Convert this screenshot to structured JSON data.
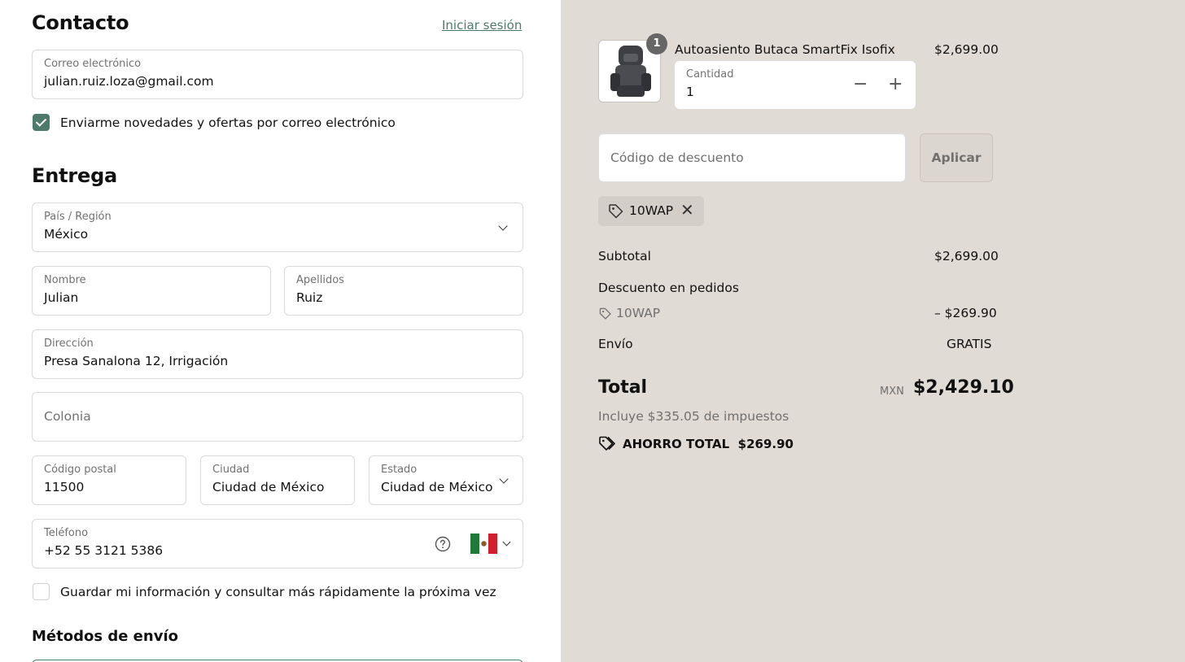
{
  "contact": {
    "title": "Contacto",
    "login_link": "Iniciar sesión",
    "email": {
      "label": "Correo electrónico",
      "value": "julian.ruiz.loza@gmail.com"
    },
    "newsletter": {
      "label": "Enviarme novedades y ofertas por correo electrónico",
      "checked": true
    }
  },
  "delivery": {
    "title": "Entrega",
    "country": {
      "label": "País / Región",
      "value": "México"
    },
    "first_name": {
      "label": "Nombre",
      "value": "Julian"
    },
    "last_name": {
      "label": "Apellidos",
      "value": "Ruiz"
    },
    "address": {
      "label": "Dirección",
      "value": "Presa Sanalona 12, Irrigación"
    },
    "colonia": {
      "placeholder": "Colonia"
    },
    "postal_code": {
      "label": "Código postal",
      "value": "11500"
    },
    "city": {
      "label": "Ciudad",
      "value": "Ciudad de México"
    },
    "state": {
      "label": "Estado",
      "value": "Ciudad de México"
    },
    "phone": {
      "label": "Teléfono",
      "value": "+52 55 3121 5386",
      "help_icon": "question-circle-icon",
      "flag_icon": "mexico-flag-icon"
    },
    "save_info": {
      "label": "Guardar mi información y consultar más rápidamente la próxima vez",
      "checked": false
    }
  },
  "shipping": {
    "title": "Métodos de envío"
  },
  "summary": {
    "product": {
      "name": "Autoasiento Butaca SmartFix Isofix",
      "price": "$2,699.00",
      "badge": "1",
      "quantity_label": "Cantidad",
      "quantity": "1",
      "minus": "−",
      "plus": "+"
    },
    "discount": {
      "placeholder": "Código de descuento",
      "apply_label": "Aplicar",
      "applied_code": "10WAP",
      "remove": "✕"
    },
    "subtotal": {
      "label": "Subtotal",
      "value": "$2,699.00"
    },
    "order_discount": {
      "label": "Descuento en pedidos",
      "code": "10WAP",
      "value": "– $269.90"
    },
    "shipping": {
      "label": "Envío",
      "value": "GRATIS"
    },
    "total": {
      "label": "Total",
      "currency": "MXN",
      "value": "$2,429.10"
    },
    "taxes": "Incluye $335.05 de impuestos",
    "savings": {
      "label": "AHORRO TOTAL",
      "value": "$269.90"
    }
  },
  "colors": {
    "accent": "#4e7a6b",
    "summary_bg": "#e1dbd6"
  }
}
